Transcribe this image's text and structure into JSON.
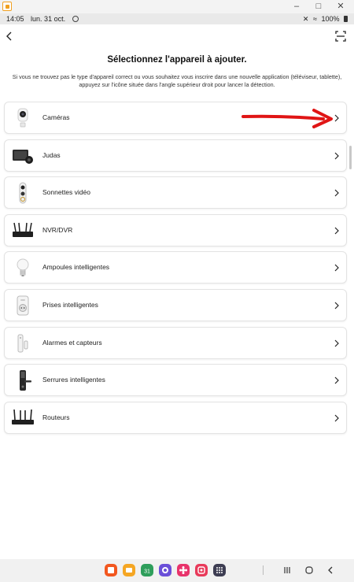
{
  "status": {
    "time": "14:05",
    "date": "lun. 31 oct.",
    "battery": "100%"
  },
  "window": {
    "minimize": "–",
    "maximize": "□",
    "close": "✕"
  },
  "header": {
    "back_icon": "back-arrow-icon",
    "scan_icon": "scan-icon"
  },
  "page": {
    "title": "Sélectionnez l'appareil à ajouter.",
    "subtitle": "Si vous ne trouvez pas le type d'appareil correct ou vous souhaitez vous inscrire dans une nouvelle application (téléviseur, tablette), appuyez sur l'icône située dans l'angle supérieur droit pour lancer la détection."
  },
  "devices": [
    {
      "label": "Caméras",
      "icon": "camera-icon"
    },
    {
      "label": "Judas",
      "icon": "door-viewer-icon"
    },
    {
      "label": "Sonnettes vidéo",
      "icon": "doorbell-icon"
    },
    {
      "label": "NVR/DVR",
      "icon": "recorder-icon"
    },
    {
      "label": "Ampoules intelligentes",
      "icon": "bulb-icon"
    },
    {
      "label": "Prises intelligentes",
      "icon": "plug-icon"
    },
    {
      "label": "Alarmes et capteurs",
      "icon": "sensor-icon"
    },
    {
      "label": "Serrures intelligentes",
      "icon": "lock-icon"
    },
    {
      "label": "Routeurs",
      "icon": "router-icon"
    }
  ],
  "dock": {
    "apps": [
      {
        "icon": "notes-icon",
        "color": "#f2571f"
      },
      {
        "icon": "folder-icon",
        "color": "#f5a623"
      },
      {
        "icon": "calendar-icon",
        "color": "#2e9e5b"
      },
      {
        "icon": "internet-icon",
        "color": "#6a4fd8"
      },
      {
        "icon": "flower-icon",
        "color": "#e8336b"
      },
      {
        "icon": "gallery-icon",
        "color": "#e83a5a"
      },
      {
        "icon": "apps-grid-icon",
        "color": "#3d3d52"
      }
    ],
    "calendar_day": "31"
  },
  "colors": {
    "annotation_arrow": "#e01515",
    "card_border": "#e3e3e3"
  }
}
